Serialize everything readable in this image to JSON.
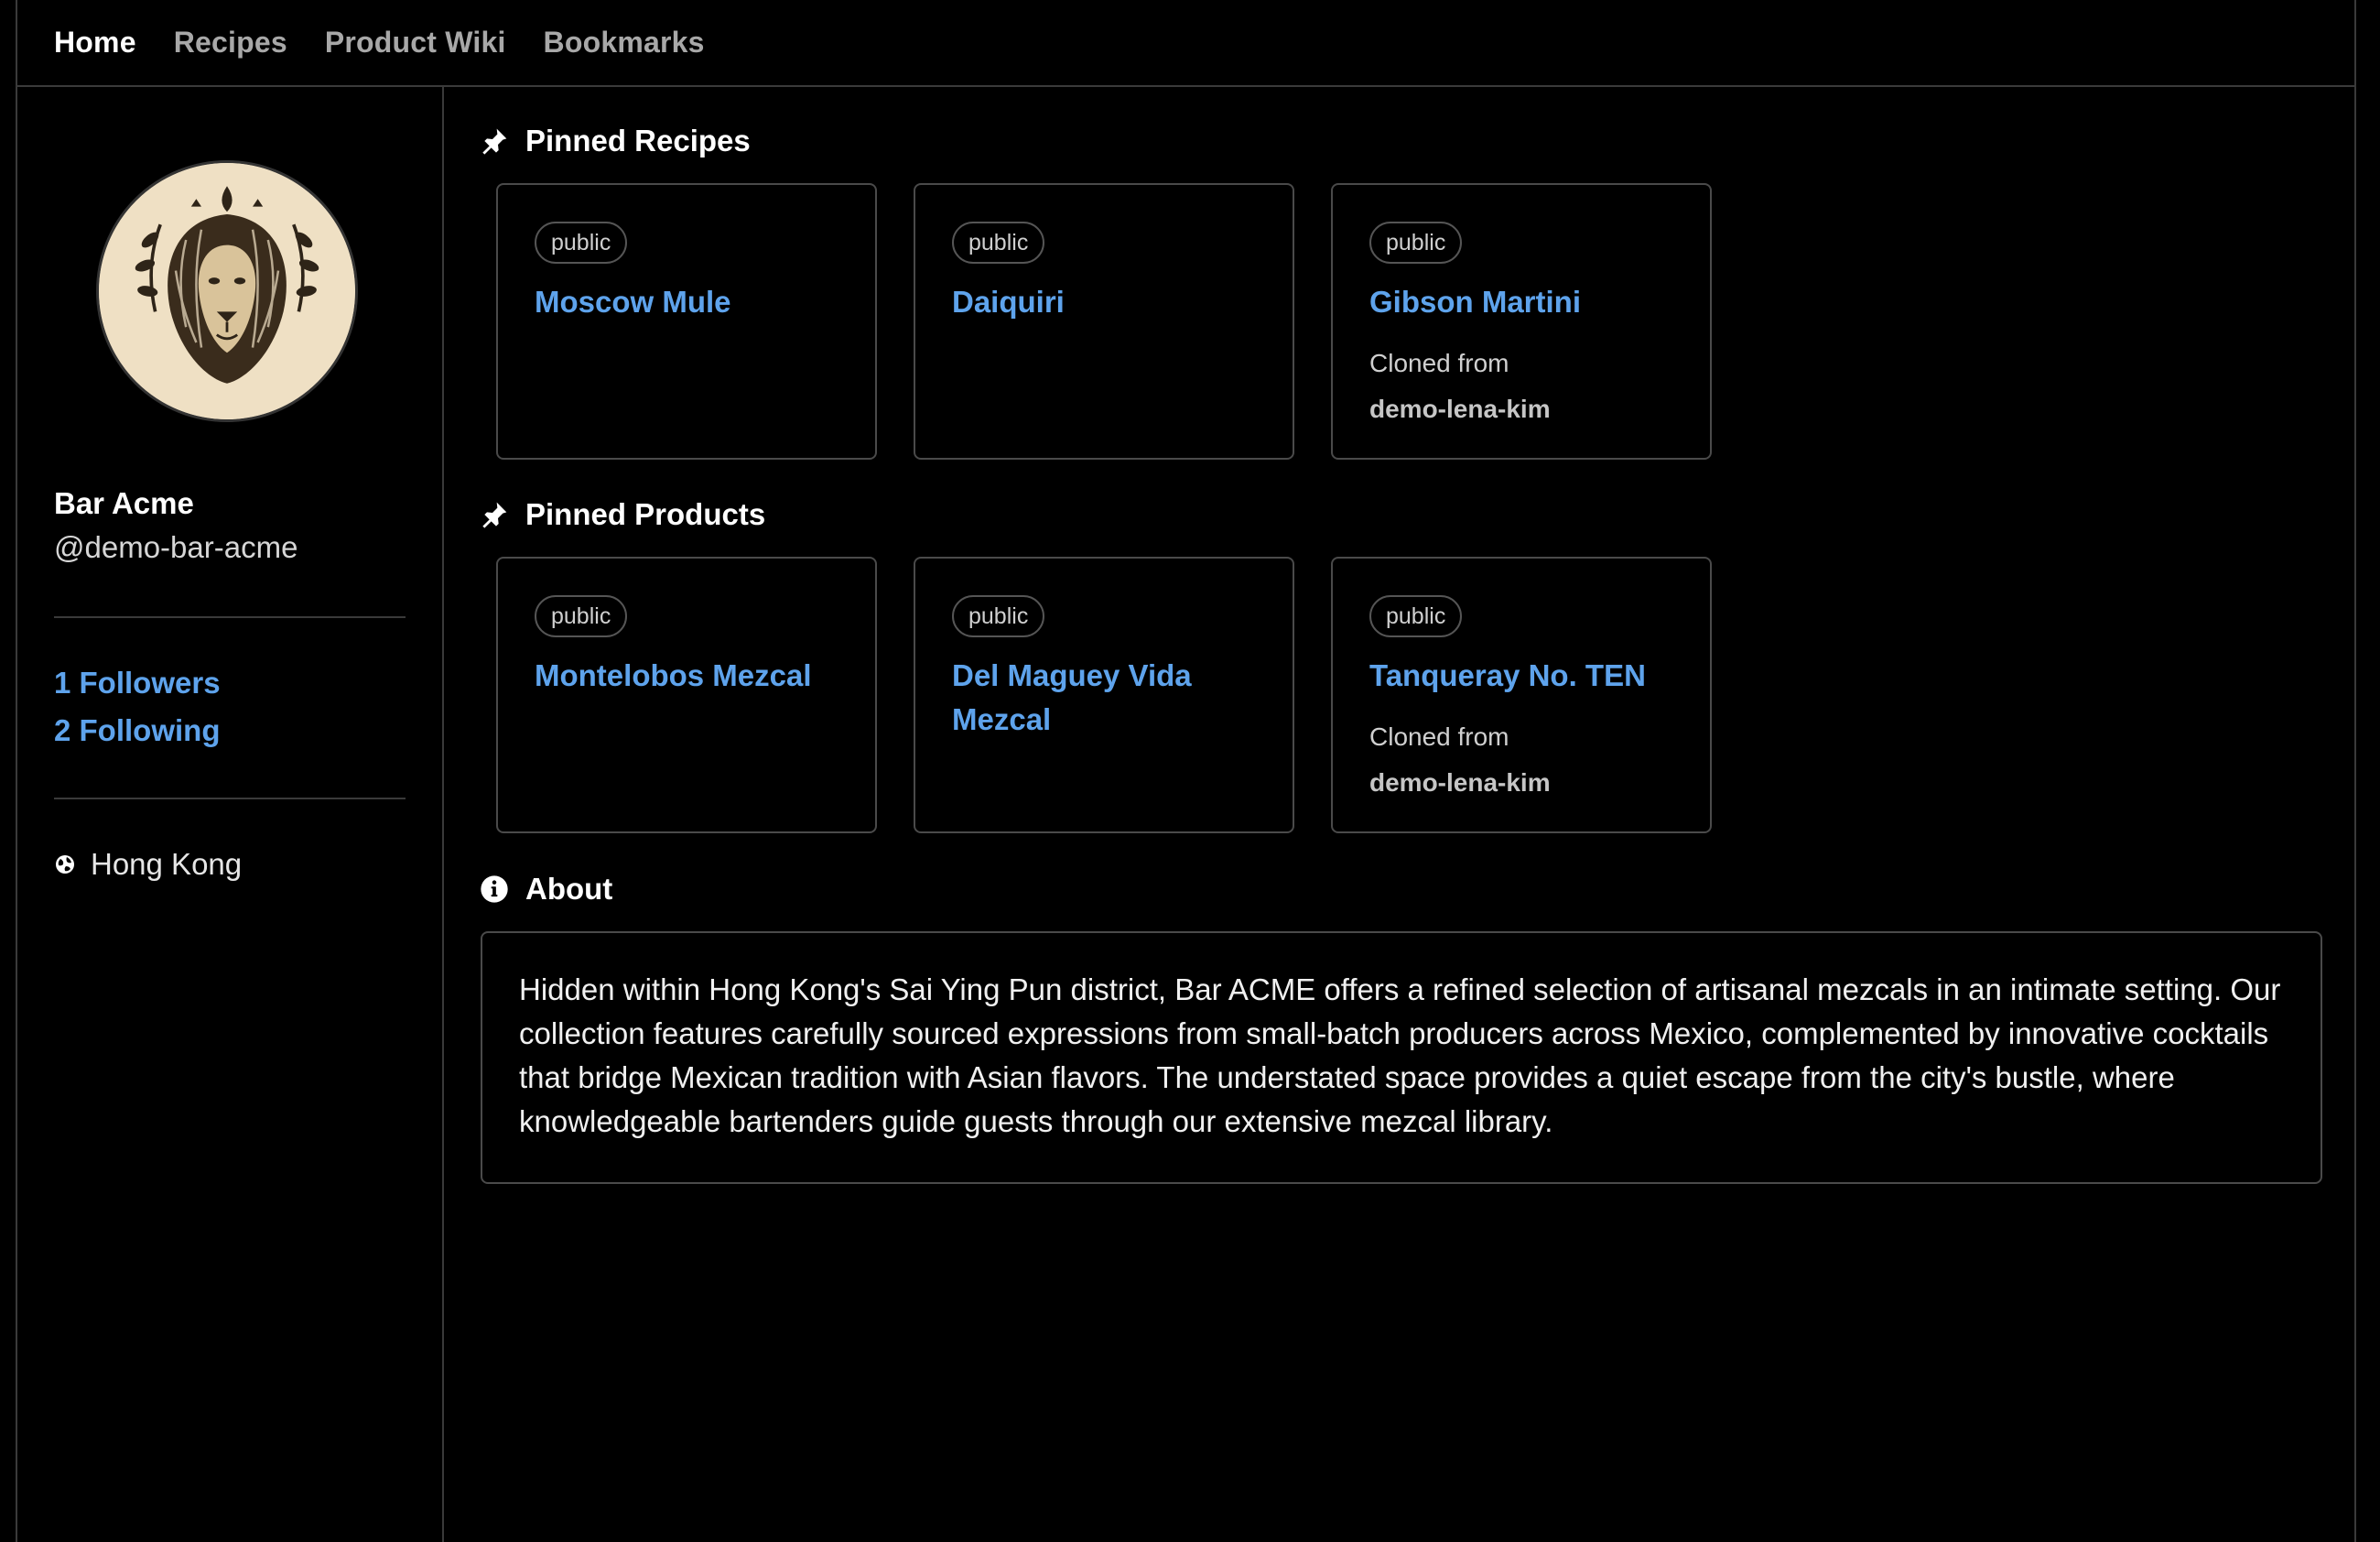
{
  "nav": {
    "items": [
      {
        "label": "Home",
        "active": true
      },
      {
        "label": "Recipes",
        "active": false
      },
      {
        "label": "Product Wiki",
        "active": false
      },
      {
        "label": "Bookmarks",
        "active": false
      }
    ]
  },
  "profile": {
    "name": "Bar Acme",
    "handle": "@demo-bar-acme",
    "followers": "1 Followers",
    "following": "2 Following",
    "location": "Hong Kong"
  },
  "pinned_recipes": {
    "title": "Pinned Recipes",
    "cards": [
      {
        "badge": "public",
        "title": "Moscow Mule"
      },
      {
        "badge": "public",
        "title": "Daiquiri"
      },
      {
        "badge": "public",
        "title": "Gibson Martini",
        "cloned_label": "Cloned from",
        "cloned_from": "demo-lena-kim"
      }
    ]
  },
  "pinned_products": {
    "title": "Pinned Products",
    "cards": [
      {
        "badge": "public",
        "title": "Montelobos Mezcal"
      },
      {
        "badge": "public",
        "title": "Del Maguey Vida Mezcal"
      },
      {
        "badge": "public",
        "title": "Tanqueray No. TEN",
        "cloned_label": "Cloned from",
        "cloned_from": "demo-lena-kim"
      }
    ]
  },
  "about": {
    "title": "About",
    "text": "Hidden within Hong Kong's Sai Ying Pun district, Bar ACME offers a refined selection of artisanal mezcals in an intimate setting. Our collection features carefully sourced expressions from small-batch producers across Mexico, complemented by innovative cocktails that bridge Mexican tradition with Asian flavors. The understated space provides a quiet escape from the city's bustle, where knowledgeable bartenders guide guests through our extensive mezcal library."
  },
  "icons": {
    "pin": "pin-icon",
    "info": "info-icon",
    "globe": "globe-icon"
  },
  "colors": {
    "link": "#5ea3ec",
    "background": "#000000",
    "border": "#4a4a4a"
  }
}
